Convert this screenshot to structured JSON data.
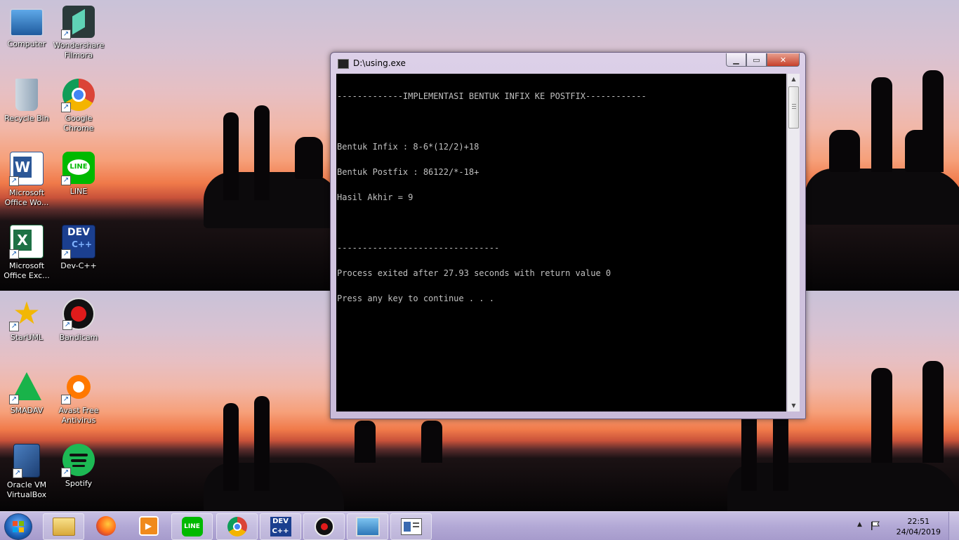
{
  "desktop": {
    "icons": [
      {
        "label": "Computer",
        "icon": "computer-icon"
      },
      {
        "label": "Wondershare\nFilmora",
        "icon": "filmora-icon"
      },
      {
        "label": "Recycle Bin",
        "icon": "recycle-bin-icon"
      },
      {
        "label": "Google\nChrome",
        "icon": "chrome-icon"
      },
      {
        "label": "Microsoft\nOffice Wo...",
        "icon": "word-icon"
      },
      {
        "label": "LINE",
        "icon": "line-icon"
      },
      {
        "label": "Microsoft\nOffice Exc...",
        "icon": "excel-icon"
      },
      {
        "label": "Dev-C++",
        "icon": "devcpp-icon"
      },
      {
        "label": "StarUML",
        "icon": "staruml-icon"
      },
      {
        "label": "Bandicam",
        "icon": "bandicam-icon"
      },
      {
        "label": "SMADAV",
        "icon": "smadav-icon"
      },
      {
        "label": "Avast Free\nAntivirus",
        "icon": "avast-icon"
      },
      {
        "label": "Oracle VM\nVirtualBox",
        "icon": "virtualbox-icon"
      },
      {
        "label": "Spotify",
        "icon": "spotify-icon"
      }
    ]
  },
  "window": {
    "title": "D:\\using.exe",
    "min_glyph": "▁",
    "max_glyph": "▭",
    "close_glyph": "✕",
    "console_lines": [
      "-------------IMPLEMENTASI BENTUK INFIX KE POSTFIX------------",
      "",
      "Bentuk Infix : 8-6*(12/2)+18",
      "Bentuk Postfix : 86122/*-18+",
      "Hasil Akhir = 9",
      "",
      "--------------------------------",
      "Process exited after 27.93 seconds with return value 0",
      "Press any key to continue . . ."
    ]
  },
  "taskbar": {
    "items": [
      "file-explorer-icon",
      "firefox-icon",
      "media-player-icon",
      "line-icon",
      "chrome-icon",
      "devcpp-icon",
      "bandicam-icon",
      "photo-viewer-icon",
      "console-window-icon"
    ],
    "active_item": "console-window-icon",
    "tray_expand_glyph": "▲",
    "time": "22:51",
    "date": "24/04/2019"
  }
}
